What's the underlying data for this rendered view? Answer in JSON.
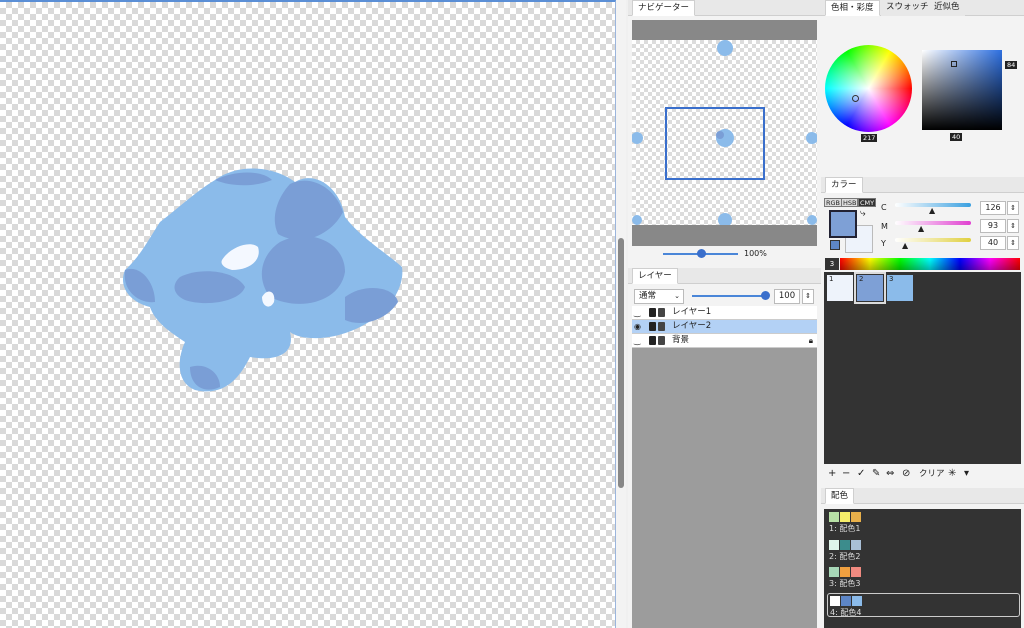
{
  "navigator": {
    "tab": "ナビゲーター",
    "zoom": "100%"
  },
  "layers": {
    "tab": "レイヤー",
    "blend_mode": "通常",
    "opacity": "100",
    "items": [
      {
        "name": "レイヤー1",
        "selected": false
      },
      {
        "name": "レイヤー2",
        "selected": true
      },
      {
        "name": "背景",
        "selected": false,
        "locked": true
      }
    ]
  },
  "color_tabs": [
    "色相・彩度",
    "スウォッチ",
    "近似色"
  ],
  "hsv": {
    "hue_badge": "217",
    "sat_badge": "84",
    "val_badge": "40"
  },
  "color_panel": {
    "tab": "カラー",
    "modes": [
      "RGB",
      "HSB",
      "CMY"
    ],
    "active_mode": "CMY",
    "sliders": [
      {
        "label": "C",
        "value": "126"
      },
      {
        "label": "M",
        "value": "93"
      },
      {
        "label": "Y",
        "value": "40"
      }
    ],
    "spectrum_label": "3"
  },
  "swatches": [
    {
      "label": "1",
      "color": "#eef3fb"
    },
    {
      "label": "2",
      "color": "#7ea0d6"
    },
    {
      "label": "3",
      "color": "#8bbbea"
    }
  ],
  "swatch_toolbar": {
    "add": "+",
    "remove": "−",
    "check": "✓",
    "edit": "✎",
    "swap": "⇔",
    "nope": "⊘",
    "clear": "クリア",
    "sparkle": "✳",
    "menu": "▾"
  },
  "palettes": {
    "tab": "配色",
    "sets": [
      {
        "label": "1: 配色1",
        "colors": [
          "#b7e0a6",
          "#f7ef6a",
          "#e8b04a"
        ]
      },
      {
        "label": "2: 配色2",
        "colors": [
          "#e0f4ea",
          "#3c8c8c",
          "#a9bfd6"
        ]
      },
      {
        "label": "3: 配色3",
        "colors": [
          "#a8d8b8",
          "#f0a040",
          "#f08a80"
        ]
      },
      {
        "label": "4: 配色4",
        "colors": [
          "#ffffff",
          "#5d86c7",
          "#8bbbea"
        ]
      }
    ]
  },
  "colors": {
    "accent": "#3a6fcc",
    "blob_light": "#8bbbea",
    "blob_dark": "#7a9ed6"
  }
}
